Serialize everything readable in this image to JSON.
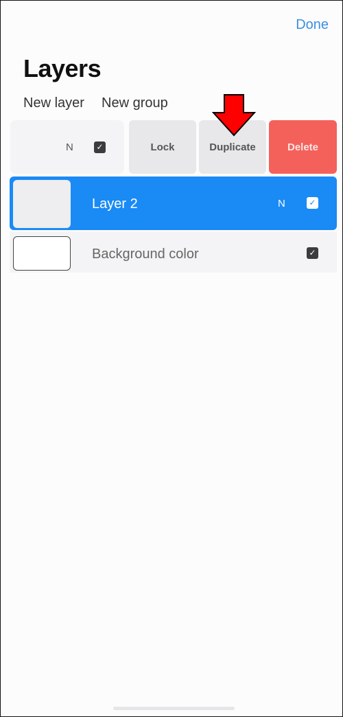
{
  "header": {
    "done_label": "Done",
    "title": "Layers"
  },
  "actions": {
    "new_layer": "New layer",
    "new_group": "New group"
  },
  "swiped_row": {
    "blend_mode": "N",
    "visible": true,
    "buttons": {
      "lock": "Lock",
      "duplicate": "Duplicate",
      "delete": "Delete"
    }
  },
  "layers": [
    {
      "name": "Layer 2",
      "blend_mode": "N",
      "visible": true,
      "selected": true
    },
    {
      "name": "Background color",
      "visible": true,
      "selected": false
    }
  ],
  "icons": {
    "check": "✓"
  },
  "colors": {
    "accent": "#1a8af5",
    "delete": "#f4615a",
    "annotation_arrow": "#ff0000"
  }
}
